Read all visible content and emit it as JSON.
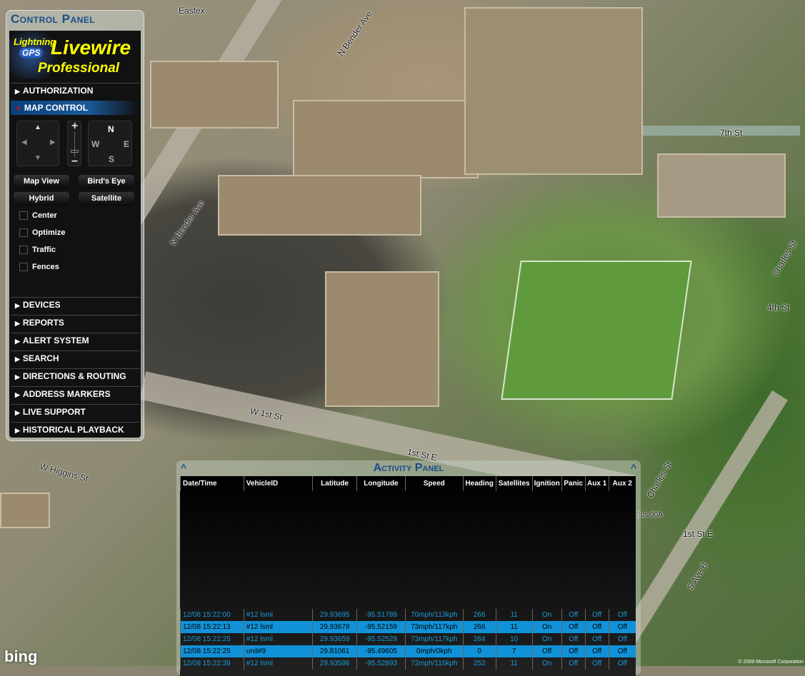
{
  "map": {
    "streets": [
      "Eastex",
      "N Bender Ave",
      "N Bender Ave",
      "7th St",
      "Charles St",
      "4th St",
      "W 1st St",
      "1st St E",
      "1st St E",
      "W Higgins St",
      "S Ave B",
      "Charles St",
      "Bus 90A"
    ],
    "brand": "bing",
    "copyright": "© 2009 Microsoft Corporation"
  },
  "control_panel": {
    "title": "Control Panel",
    "logo": {
      "line1": "Lightning",
      "line2": "GPS",
      "line3": "Livewire",
      "line4": "Professional"
    },
    "authorization": "AUTHORIZATION",
    "map_control": "MAP CONTROL",
    "compass": {
      "n": "N",
      "w": "W",
      "e": "E",
      "s": "S"
    },
    "zoom_in": "+",
    "zoom_out": "−",
    "views": [
      "Map View",
      "Bird's Eye",
      "Hybrid",
      "Satellite"
    ],
    "options": [
      "Center",
      "Optimize",
      "Traffic",
      "Fences"
    ],
    "sections": [
      "DEVICES",
      "REPORTS",
      "ALERT SYSTEM",
      "SEARCH",
      "DIRECTIONS & ROUTING",
      "ADDRESS MARKERS",
      "LIVE SUPPORT",
      "HISTORICAL PLAYBACK"
    ]
  },
  "activity_panel": {
    "title": "Activity Panel",
    "columns": [
      "Date/Time",
      "VehicleID",
      "Latitude",
      "Longitude",
      "Speed",
      "Heading",
      "Satellites",
      "Ignition",
      "Panic",
      "Aux 1",
      "Aux 2"
    ],
    "rows": [
      [
        "12/08 15:22:00",
        "#12 lsml",
        "29.93695",
        "-95.51789",
        "70mph/113kph",
        "266",
        "11",
        "On",
        "Off",
        "Off",
        "Off"
      ],
      [
        "12/08 15:22:13",
        "#12 lsml",
        "29.93678",
        "-95.52159",
        "73mph/117kph",
        "266",
        "11",
        "On",
        "Off",
        "Off",
        "Off"
      ],
      [
        "12/08 15:22:25",
        "#12 lsml",
        "29.93659",
        "-95.52529",
        "73mph/117kph",
        "264",
        "10",
        "On",
        "Off",
        "Off",
        "Off"
      ],
      [
        "12/08 15:22:25",
        "unit#9",
        "29.81061",
        "-95.49605",
        "0mph/0kph",
        "0",
        "7",
        "Off",
        "Off",
        "Off",
        "Off"
      ],
      [
        "12/08 15:22:39",
        "#12 lsml",
        "29.93596",
        "-95.52893",
        "72mph/116kph",
        "252",
        "11",
        "On",
        "Off",
        "Off",
        "Off"
      ]
    ],
    "selected_rows": [
      1,
      3
    ]
  }
}
